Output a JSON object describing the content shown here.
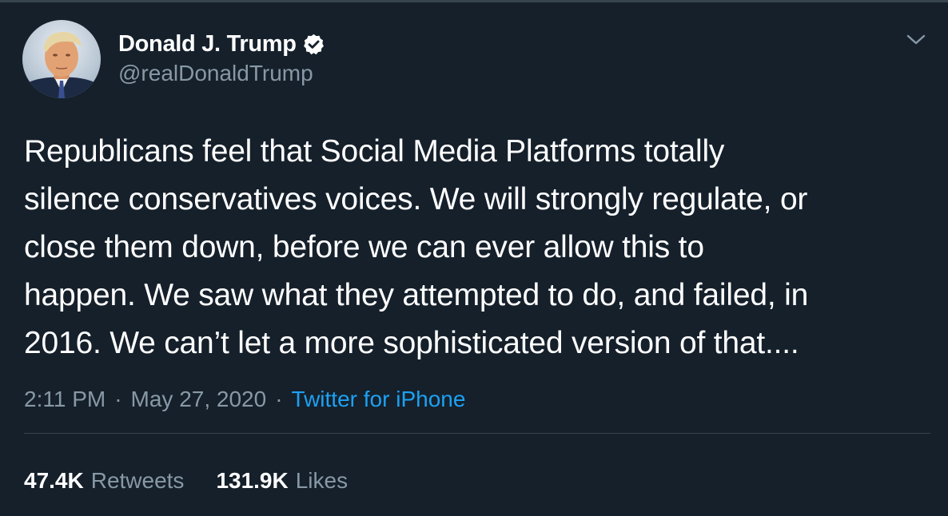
{
  "author": {
    "display_name": "Donald J. Trump",
    "handle": "@realDonaldTrump",
    "avatar": "profile-photo",
    "verified_icon": "verified-badge-icon"
  },
  "menu": {
    "icon": "chevron-down-icon"
  },
  "tweet": {
    "text": "Republicans feel that Social Media Platforms totally\nsilence conservatives voices. We will strongly regulate, or\nclose them down, before we can ever allow this to\nhappen. We saw what they attempted to do, and failed, in\n2016. We can’t let a more sophisticated version of that...."
  },
  "meta": {
    "time": "2:11 PM",
    "separator": "·",
    "date": "May 27, 2020",
    "source": "Twitter for iPhone"
  },
  "stats": {
    "retweets_count": "47.4K",
    "retweets_label": "Retweets",
    "likes_count": "131.9K",
    "likes_label": "Likes"
  },
  "colors": {
    "background": "#15202b",
    "secondary_text": "#8899a6",
    "link": "#1da1f2",
    "border": "#38444d"
  }
}
